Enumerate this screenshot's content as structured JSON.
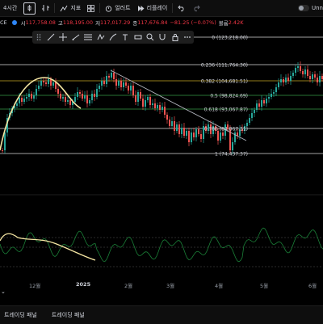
{
  "toolbar": {
    "interval": "4시간",
    "chart_type_icon": "candle-icon",
    "indicators_label": "지표",
    "templates_icon": "grid-icon",
    "alert_label": "얼러트",
    "replay_label": "리플레이",
    "undo_icon": "undo-icon",
    "redo_icon": "redo-icon",
    "right_label": "Unn"
  },
  "legend": {
    "symbol": "CE",
    "open_label": "시",
    "open": "117,758.08",
    "high_label": "고",
    "high": "118,195.00",
    "low_label": "저",
    "low": "117,017.29",
    "close_label": "종",
    "close": "117,676.84",
    "change": "−81.25 (−0.07%)",
    "volume_label": "볼륨",
    "volume": "2.42K"
  },
  "fib_levels": [
    {
      "label": "0 (123,218.00)",
      "color": "#ffffff"
    },
    {
      "label": "0.236 (111,764.30)",
      "color": "#ffffff"
    },
    {
      "label": "0.382 (104,681.51)",
      "color": "#e6c229"
    },
    {
      "label": "0.5 (98,824.69)",
      "color": "#3fb950"
    },
    {
      "label": "0.618 (93,067.87)",
      "color": "#3fb950"
    },
    {
      "label": "0.786 (84,867.31)",
      "color": "#ffffff"
    },
    {
      "label": "1 (74,437.37)",
      "color": "#ffffff"
    }
  ],
  "time_axis": [
    {
      "label": "12월",
      "bold": false
    },
    {
      "label": "2025",
      "bold": true
    },
    {
      "label": "2월",
      "bold": false
    },
    {
      "label": "3월",
      "bold": false
    },
    {
      "label": "4월",
      "bold": false
    },
    {
      "label": "5월",
      "bold": false
    },
    {
      "label": "6월",
      "bold": false
    }
  ],
  "bottom_tabs": [
    "트레이딩 패널",
    "트레이딩 패널"
  ],
  "colors": {
    "up": "#26a69a",
    "down": "#ef5350",
    "trendline": "#b2b5be",
    "indicator_line": "#1a7f37",
    "highlight": "#f5e6a3"
  }
}
